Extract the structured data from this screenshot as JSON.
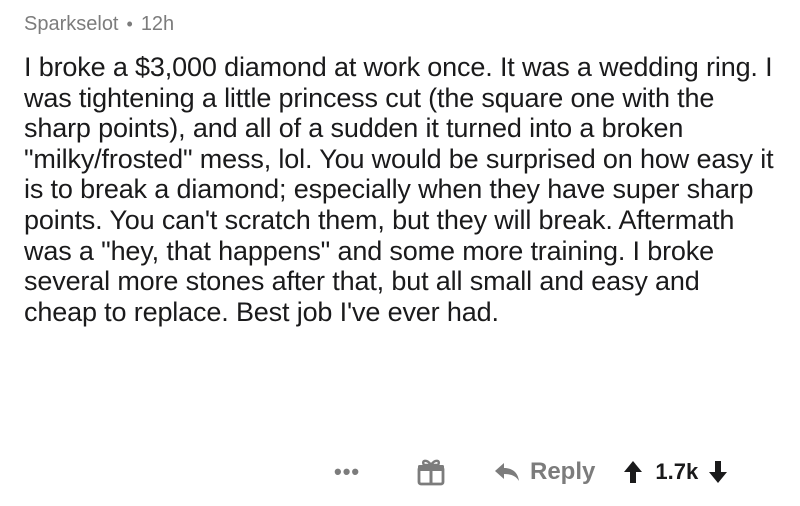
{
  "comment": {
    "username": "Sparkselot",
    "separator": "•",
    "age": "12h",
    "text": "I broke a $3,000 diamond at work once. It was a wedding ring. I was tightening a little princess cut (the square one with the sharp points), and all of a sudden it turned into a broken \"milky/frosted\" mess, lol. You would be surprised on how easy it is to break a diamond; especially when they have super sharp points. You can't scratch them, but they will break. Aftermath was a \"hey, that happens\" and some more training. I broke several more stones after that, but all small and easy and cheap to replace. Best job I've ever had."
  },
  "actions": {
    "more_label": "•••",
    "award_icon": "gift-icon",
    "reply_icon": "reply-arrow-icon",
    "reply_label": "Reply",
    "upvote_icon": "upvote-arrow-icon",
    "score": "1.7k",
    "downvote_icon": "downvote-arrow-icon"
  },
  "colors": {
    "text": "#1a1a1b",
    "meta": "#7c7c7c"
  }
}
